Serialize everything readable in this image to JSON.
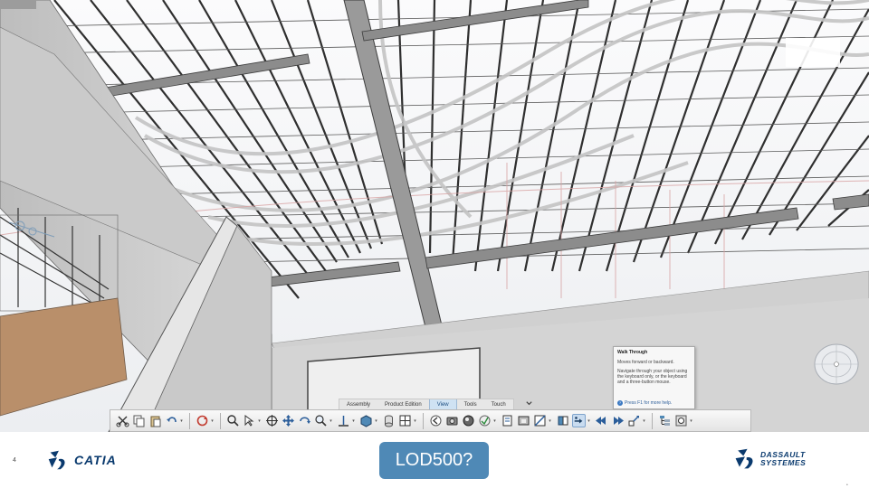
{
  "viewport": {
    "colors": {
      "sky": "#f4f5f7",
      "steel": "#3a3a3a",
      "pipe": "#bdbdbd",
      "wall": "#cfcfcf",
      "beam": "#7f7f7f",
      "accent_line": "#c07070",
      "brown_panel": "#b98f6a"
    }
  },
  "context_tabs": {
    "items": [
      {
        "label": "Assembly",
        "active": false
      },
      {
        "label": "Product Edition",
        "active": false
      },
      {
        "label": "View",
        "active": true
      },
      {
        "label": "Tools",
        "active": false
      },
      {
        "label": "Touch",
        "active": false
      }
    ],
    "toggle_icon": "chevron-down-icon"
  },
  "action_bar": {
    "groups": [
      [
        "cut-icon",
        "copy-icon",
        "paste-icon",
        "undo-icon"
      ],
      [
        "update-icon"
      ],
      [
        "search-icon",
        "select-icon",
        "fit-all-icon",
        "pan-icon",
        "rotate-icon",
        "zoom-icon",
        "normal-view-icon",
        "shading-icon",
        "cylinder-icon",
        "multi-view-icon"
      ],
      [
        "previous-icon",
        "capture-icon",
        "render-icon",
        "material-icon",
        "catalog-icon",
        "hide-show-icon",
        "section-icon",
        "clipping-icon",
        "walk-through-icon",
        "step-back-icon",
        "step-forward-icon",
        "speed-icon"
      ],
      [
        "tree-icon",
        "settings-icon"
      ]
    ]
  },
  "tooltip": {
    "title": "Walk Through",
    "line1": "Moves forward or backward.",
    "line2": "Navigate through your object using the keyboard only, or the keyboard and a three-button mouse.",
    "help": "Press F1 for more help."
  },
  "compass": {
    "icon": "compass-icon"
  },
  "footer": {
    "page_number": "4",
    "catia_logo_text": "CATIA",
    "badge_text": "LOD500?",
    "ds_logo_line1": "DASSAULT",
    "ds_logo_line2": "SYSTEMES",
    "badge_color": "#4f89b6",
    "brand_color": "#0a3a6e"
  }
}
